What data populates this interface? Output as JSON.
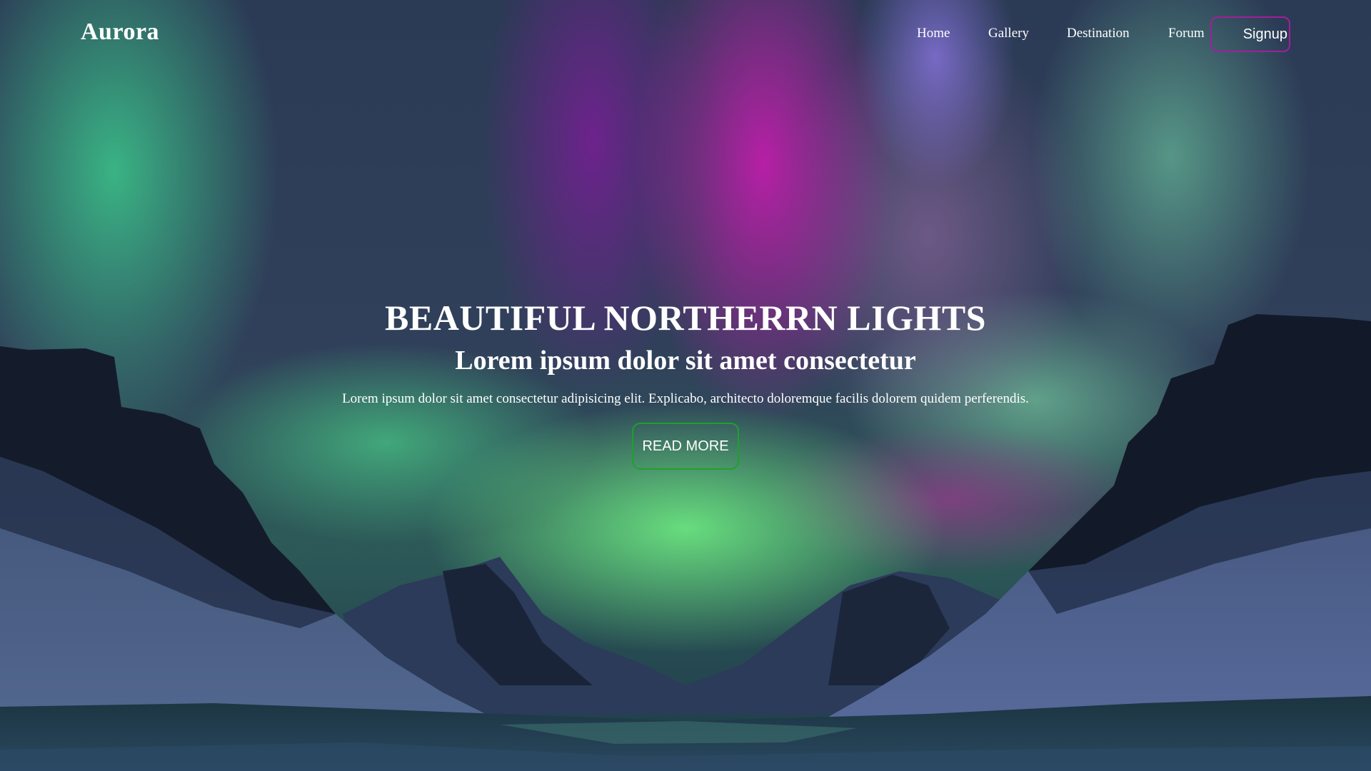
{
  "brand": {
    "logo": "Aurora"
  },
  "nav": {
    "items": [
      {
        "label": "Home"
      },
      {
        "label": "Gallery"
      },
      {
        "label": "Destination"
      },
      {
        "label": "Forum"
      }
    ],
    "signup_label": "Signup"
  },
  "hero": {
    "title": "BEAUTIFUL NORTHERRN LIGHTS",
    "subtitle": "Lorem ipsum dolor sit amet consectetur",
    "description": "Lorem ipsum dolor sit amet consectetur adipisicing elit. Explicabo, architecto doloremque facilis dolorem quidem perferendis.",
    "cta_label": "READ MORE"
  },
  "colors": {
    "text": "#ffffff",
    "signup_border": "#a0209a",
    "cta_border": "#1fa02c"
  }
}
